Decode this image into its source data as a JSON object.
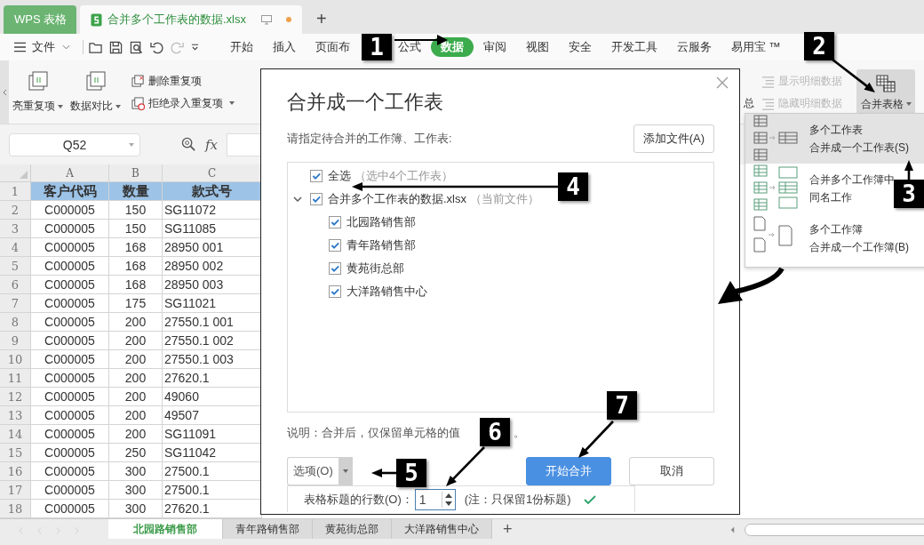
{
  "app_tabs": [
    {
      "label": "WPS 表格",
      "kind": "app",
      "selected": false
    },
    {
      "label": "合并多个工作表的数据.xlsx",
      "kind": "file",
      "selected": true
    }
  ],
  "new_tab": "+",
  "menu": {
    "file": "文件",
    "items": [
      {
        "label": "开始",
        "selected": false
      },
      {
        "label": "插入",
        "selected": false
      },
      {
        "label": "页面布",
        "selected": false
      },
      {
        "label": "公式",
        "selected": false
      },
      {
        "label": "数据",
        "selected": true
      },
      {
        "label": "审阅",
        "selected": false
      },
      {
        "label": "视图",
        "selected": false
      },
      {
        "label": "安全",
        "selected": false
      },
      {
        "label": "开发工具",
        "selected": false
      },
      {
        "label": "云服务",
        "selected": false
      },
      {
        "label": "易用宝 ™",
        "selected": false
      }
    ]
  },
  "ribbon": {
    "large": [
      {
        "label": "亮重复项"
      },
      {
        "label": "数据对比"
      }
    ],
    "small": [
      {
        "label": "删除重复项",
        "dropdown": false
      },
      {
        "label": "拒绝录入重复项",
        "dropdown": true
      }
    ],
    "partial": "总",
    "outline": [
      {
        "label": "显示明细数据",
        "disabled": true
      },
      {
        "label": "隐藏明细数据",
        "disabled": true
      }
    ],
    "merge": {
      "label": "合并表格",
      "selected": true
    }
  },
  "formula_bar": {
    "name_box": "Q52",
    "fx": "fx"
  },
  "sheet": {
    "columns": [
      "A",
      "B",
      "C"
    ],
    "header": {
      "n": "1",
      "cells": [
        "客户代码",
        "数量",
        "款式号"
      ]
    },
    "rows": [
      {
        "n": "2",
        "cells": [
          "C000005",
          "150",
          "SG11072"
        ]
      },
      {
        "n": "3",
        "cells": [
          "C000005",
          "150",
          "SG11085"
        ]
      },
      {
        "n": "4",
        "cells": [
          "C000005",
          "168",
          "28950 001"
        ]
      },
      {
        "n": "5",
        "cells": [
          "C000005",
          "168",
          "28950 002"
        ]
      },
      {
        "n": "6",
        "cells": [
          "C000005",
          "168",
          "28950 003"
        ]
      },
      {
        "n": "7",
        "cells": [
          "C000005",
          "175",
          "SG11021"
        ]
      },
      {
        "n": "8",
        "cells": [
          "C000005",
          "200",
          "27550.1 001"
        ]
      },
      {
        "n": "9",
        "cells": [
          "C000005",
          "200",
          "27550.1 002"
        ]
      },
      {
        "n": "10",
        "cells": [
          "C000005",
          "200",
          "27550.1 003"
        ]
      },
      {
        "n": "11",
        "cells": [
          "C000005",
          "200",
          "27620.1"
        ]
      },
      {
        "n": "12",
        "cells": [
          "C000005",
          "200",
          "49060"
        ]
      },
      {
        "n": "13",
        "cells": [
          "C000005",
          "200",
          "49507"
        ]
      },
      {
        "n": "14",
        "cells": [
          "C000005",
          "200",
          "SG11091"
        ]
      },
      {
        "n": "15",
        "cells": [
          "C000005",
          "250",
          "SG11042"
        ]
      },
      {
        "n": "16",
        "cells": [
          "C000005",
          "300",
          "27500.1"
        ]
      },
      {
        "n": "17",
        "cells": [
          "C000005",
          "300",
          "27500.1"
        ]
      },
      {
        "n": "18",
        "cells": [
          "C000005",
          "300",
          "27620.1"
        ]
      }
    ]
  },
  "sheet_tabs": [
    {
      "label": "北园路销售部",
      "selected": true
    },
    {
      "label": "青年路销售部",
      "selected": false
    },
    {
      "label": "黄苑街总部",
      "selected": false
    },
    {
      "label": "大洋路销售中心",
      "selected": false
    }
  ],
  "add_sheet": "+",
  "dialog": {
    "title": "合并成一个工作表",
    "prompt": "请指定待合并的工作簿、工作表:",
    "add_file": "添加文件(A)",
    "select_all": {
      "label": "全选",
      "note": "（选中4个工作表）",
      "checked": true
    },
    "workbook": {
      "label": "合并多个工作表的数据.xlsx",
      "note": "（当前文件）",
      "checked": true,
      "expanded": true,
      "children": [
        {
          "label": "北园路销售部",
          "checked": true
        },
        {
          "label": "青年路销售部",
          "checked": true
        },
        {
          "label": "黄苑街总部",
          "checked": true
        },
        {
          "label": "大洋路销售中心",
          "checked": true
        }
      ]
    },
    "note": "说明：合并后，仅保留单元格的值",
    "note_end": "。",
    "options": "选项(O)",
    "start": "开始合并",
    "cancel": "取消",
    "header_rows": {
      "label": "表格标题的行数(O)：",
      "value": "1",
      "hint": "(注：只保留1份标题)",
      "valid": true
    }
  },
  "merge_menu": [
    {
      "kind": "sheets",
      "line1": "多个工作表",
      "line2": "合并成一个工作表(S)",
      "selected": true
    },
    {
      "kind": "samename",
      "line1": "合并多个工作簿中",
      "line2": "同名工作",
      "selected": false
    },
    {
      "kind": "books",
      "line1": "多个工作簿",
      "line2": "合并成一个工作簿(B)",
      "selected": false
    }
  ],
  "annotations": [
    "1",
    "2",
    "3",
    "4",
    "5",
    "6",
    "7"
  ]
}
